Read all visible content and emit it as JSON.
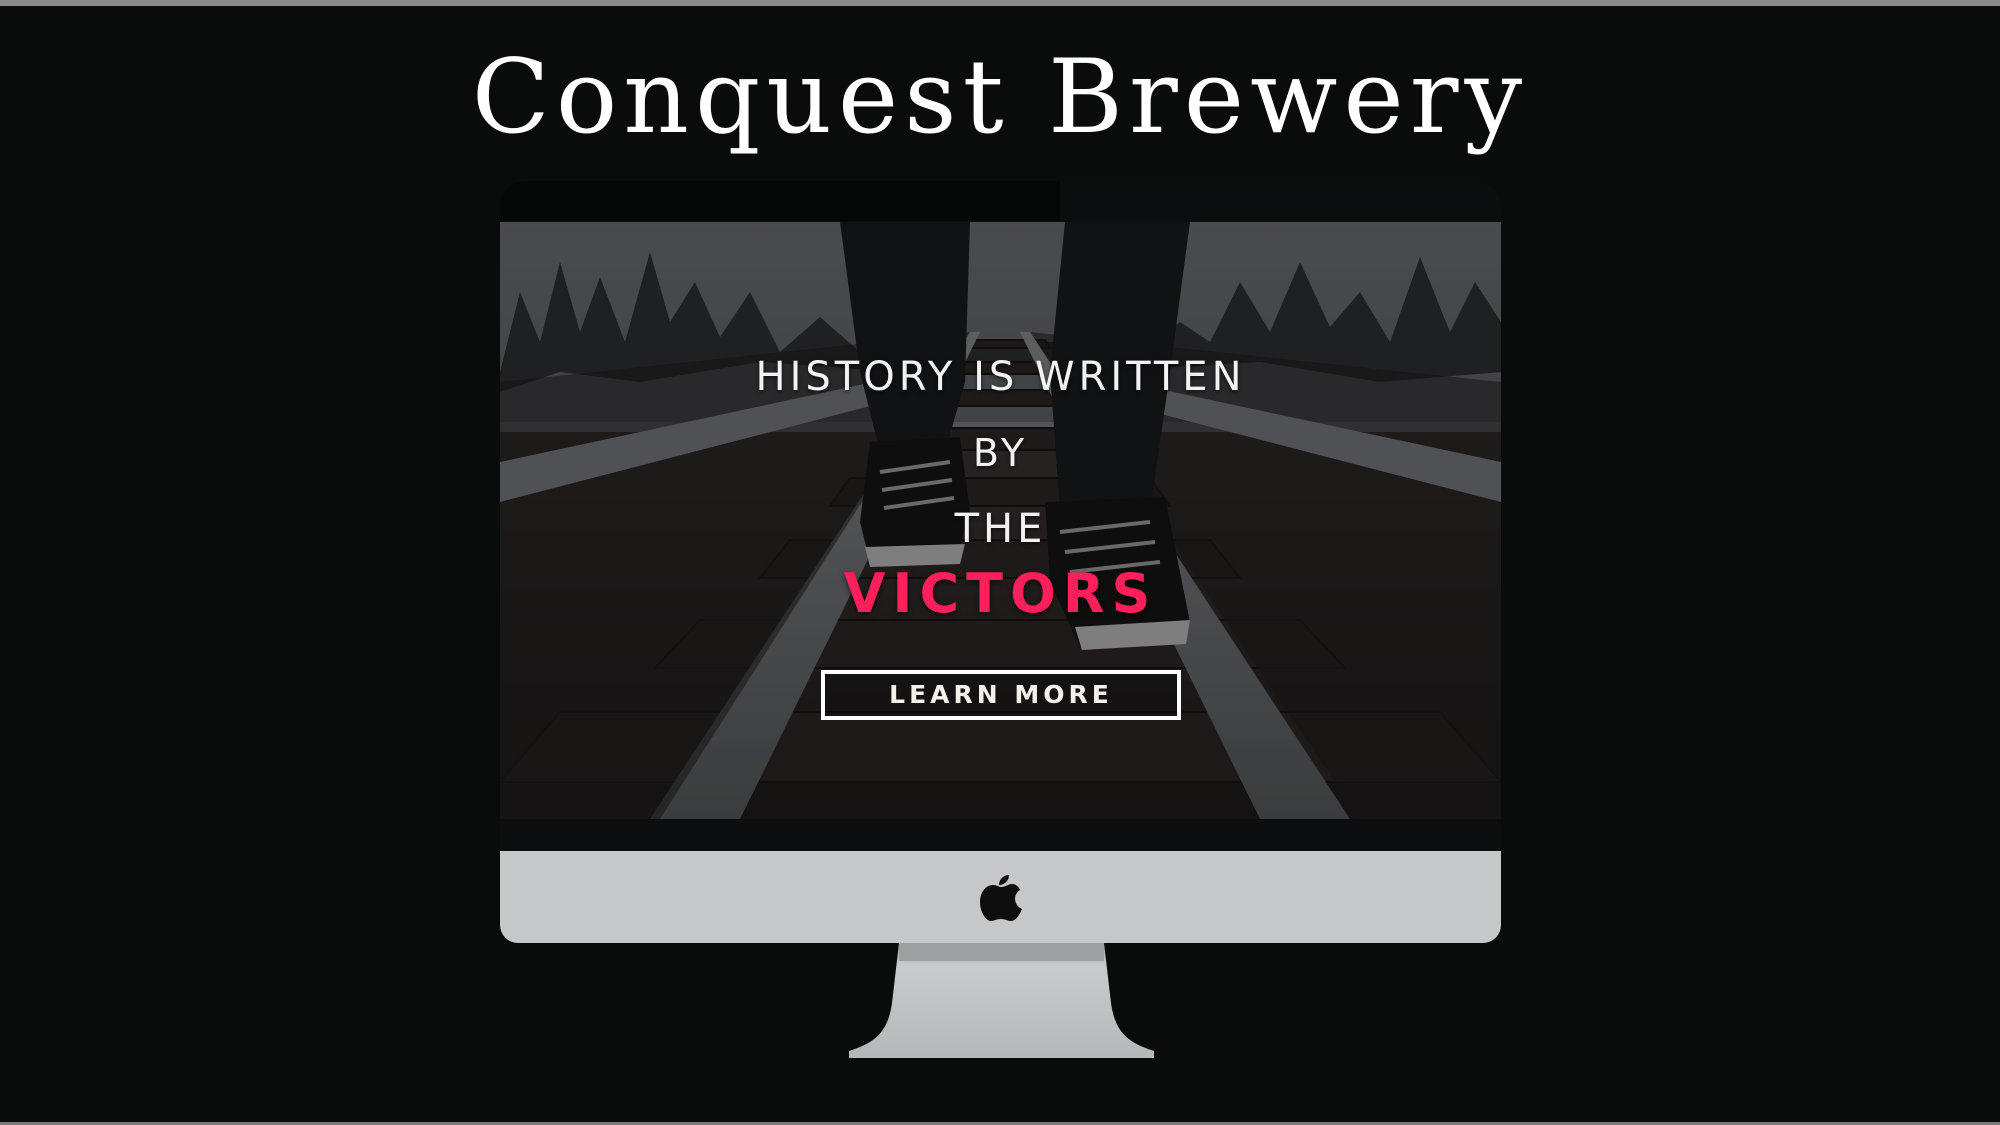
{
  "page": {
    "title": "Conquest Brewery"
  },
  "hero": {
    "line1": "HISTORY IS WRITTEN",
    "line2": "BY",
    "line3": "THE",
    "accent_word": "VICTORS",
    "accent_color": "#ff1f5a",
    "button_label": "LEARN MORE"
  },
  "device": {
    "logo_icon": "apple-logo-icon"
  },
  "colors": {
    "background": "#0a0b0b",
    "chin": "#c6c7c9",
    "text": "#ffffff"
  }
}
